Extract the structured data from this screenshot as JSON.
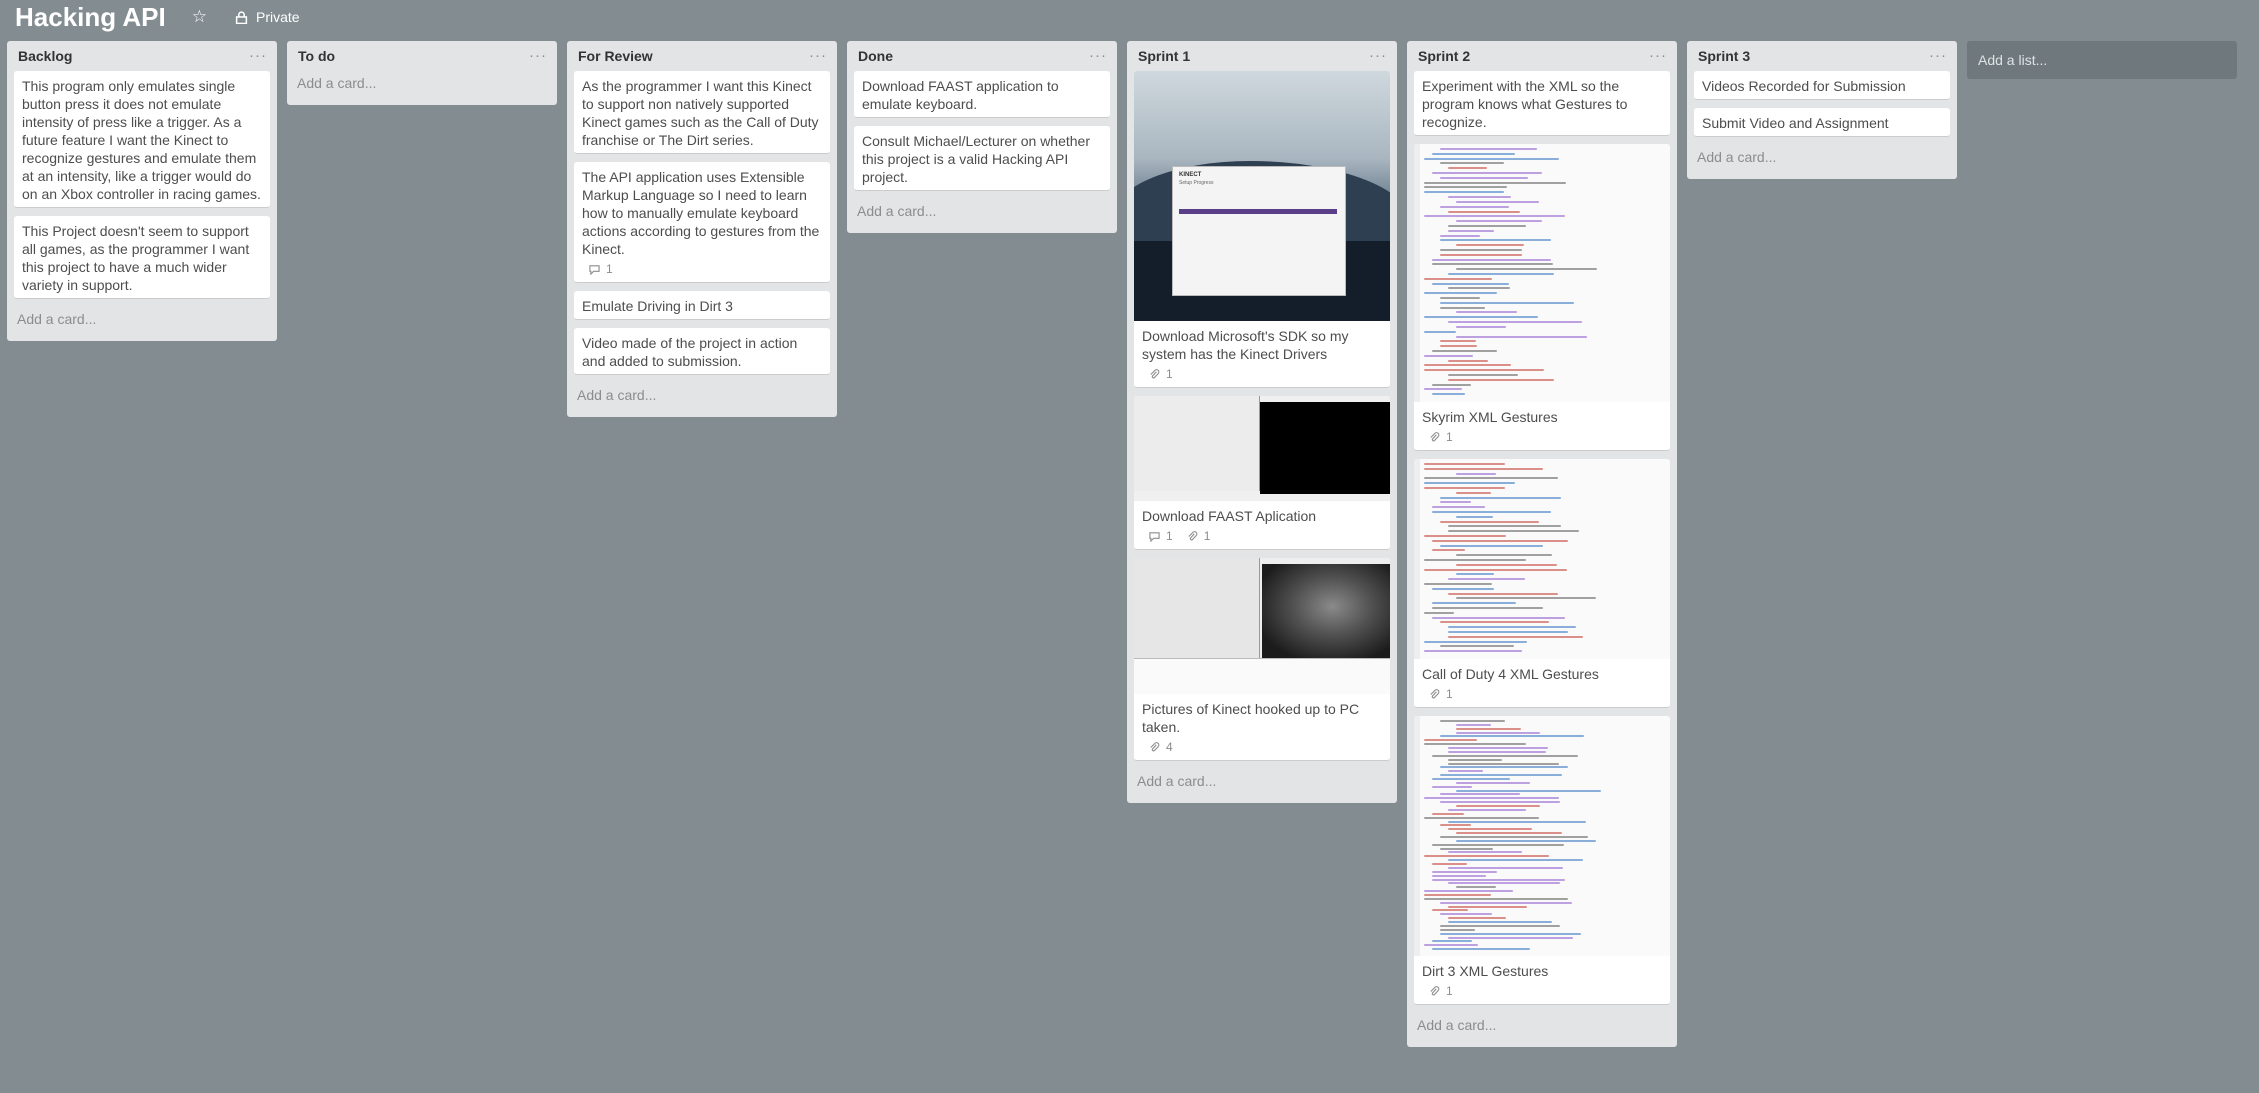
{
  "header": {
    "board_title": "Hacking API",
    "star_icon": "star-icon",
    "privacy_label": "Private",
    "lock_icon": "lock-icon"
  },
  "colors": {
    "board_background": "#838c91",
    "list_background": "#e2e4e6",
    "card_background": "#ffffff",
    "add_list_background": "#6f787d",
    "progress_bar": "#5a3e88"
  },
  "add_card_label": "Add a card...",
  "add_list_label": "Add a list...",
  "lists": [
    {
      "title": "Backlog",
      "cards": [
        {
          "text": "This program only emulates single button press it does not emulate intensity of press like a trigger. As a future feature I want the Kinect to recognize gestures and emulate them at an intensity, like a trigger would do on an Xbox controller in racing games."
        },
        {
          "text": "This Project doesn't seem to support all games, as the programmer I want this project to have a much wider variety in support."
        }
      ]
    },
    {
      "title": "To do",
      "cards": []
    },
    {
      "title": "For Review",
      "cards": [
        {
          "text": "As the programmer I want this Kinect to support non natively supported Kinect games such as the Call of Duty franchise or The Dirt series."
        },
        {
          "text": "The API application uses Extensible Markup Language so I need to learn how to manually emulate keyboard actions according to gestures from the Kinect.",
          "comments": "1"
        },
        {
          "text": "Emulate Driving in Dirt 3"
        },
        {
          "text": "Video made of the project in action and added to submission."
        }
      ]
    },
    {
      "title": "Done",
      "cards": [
        {
          "text": "Download FAAST application to emulate keyboard."
        },
        {
          "text": "Consult Michael/Lecturer on whether this project is a valid Hacking API project."
        }
      ]
    },
    {
      "title": "Sprint 1",
      "cards": [
        {
          "text": "Download Microsoft's SDK so my system has the Kinect Drivers",
          "attachments": "1",
          "thumb_label": "KINECT",
          "thumb_sub": "Setup Progress"
        },
        {
          "text": "Download FAAST Aplication",
          "comments": "1",
          "attachments": "1"
        },
        {
          "text": "Pictures of Kinect hooked up to PC taken.",
          "attachments": "4"
        }
      ]
    },
    {
      "title": "Sprint 2",
      "cards": [
        {
          "text": "Experiment with the XML so the program knows what Gestures to recognize."
        },
        {
          "text": "Skyrim XML Gestures",
          "attachments": "1"
        },
        {
          "text": "Call of Duty 4 XML Gestures",
          "attachments": "1"
        },
        {
          "text": "Dirt 3 XML Gestures",
          "attachments": "1"
        }
      ]
    },
    {
      "title": "Sprint 3",
      "cards": [
        {
          "text": "Videos Recorded for Submission"
        },
        {
          "text": "Submit Video and Assignment"
        }
      ]
    }
  ]
}
